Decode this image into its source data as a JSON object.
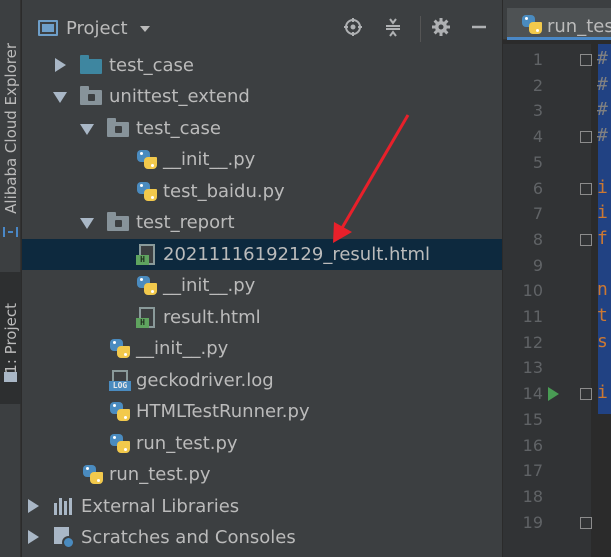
{
  "sidebar": {
    "cloud_label": "Alibaba Cloud Explorer",
    "project_label": "1: Project"
  },
  "panel": {
    "title": "Project",
    "icons": [
      "locate-icon",
      "collapse-all-icon",
      "gear-icon",
      "hide-icon"
    ]
  },
  "tree": [
    {
      "label": "test_case",
      "type": "folder-blue",
      "expanded": false
    },
    {
      "label": "unittest_extend",
      "type": "package",
      "expanded": true
    },
    {
      "label": "test_case",
      "type": "package",
      "expanded": true
    },
    {
      "label": "__init__.py",
      "type": "python"
    },
    {
      "label": "test_baidu.py",
      "type": "python"
    },
    {
      "label": "test_report",
      "type": "package",
      "expanded": true
    },
    {
      "label": "20211116192129_result.html",
      "type": "html",
      "selected": true
    },
    {
      "label": "__init__.py",
      "type": "python"
    },
    {
      "label": "result.html",
      "type": "html"
    },
    {
      "label": "__init__.py",
      "type": "python"
    },
    {
      "label": "geckodriver.log",
      "type": "log"
    },
    {
      "label": "HTMLTestRunner.py",
      "type": "python"
    },
    {
      "label": "run_test.py",
      "type": "python"
    },
    {
      "label": "run_test.py",
      "type": "python"
    },
    {
      "label": "External Libraries",
      "type": "libraries",
      "expanded": false
    },
    {
      "label": "Scratches and Consoles",
      "type": "scratches",
      "expanded": false
    }
  ],
  "icon_badges": {
    "html": "H",
    "log": "LOG"
  },
  "editor": {
    "tab_label": "run_test",
    "line_numbers": [
      "1",
      "2",
      "3",
      "4",
      "5",
      "6",
      "7",
      "8",
      "9",
      "10",
      "11",
      "12",
      "13",
      "14",
      "15",
      "16",
      "17",
      "18",
      "19"
    ],
    "code_chars": {
      "1": "#",
      "2": "#",
      "3": "#",
      "4": "#",
      "6": "i",
      "7": "i",
      "8": "f",
      "10": "n",
      "11": "t",
      "12": "s",
      "14": "i"
    }
  },
  "colors": {
    "annotation_arrow": "#e8202a",
    "selection": "#0d293e",
    "accent_tab": "#4a88c7"
  }
}
